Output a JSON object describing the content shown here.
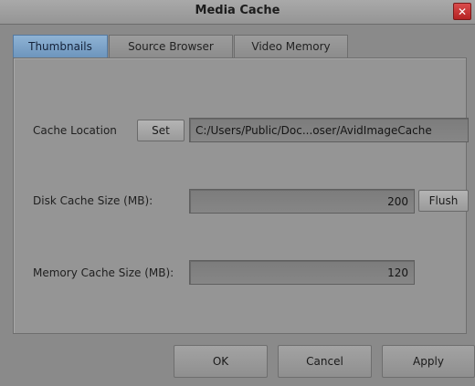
{
  "window": {
    "title": "Media Cache",
    "close_glyph": "✕"
  },
  "tabs": [
    {
      "label": "Thumbnails",
      "active": true
    },
    {
      "label": "Source Browser",
      "active": false
    },
    {
      "label": "Video Memory",
      "active": false
    }
  ],
  "cache_location": {
    "label": "Cache Location",
    "set_label": "Set",
    "path": "C:/Users/Public/Doc...oser/AvidImageCache"
  },
  "disk_cache": {
    "label": "Disk Cache Size (MB):",
    "value": "200",
    "flush_label": "Flush"
  },
  "memory_cache": {
    "label": "Memory Cache Size (MB):",
    "value": "120"
  },
  "footer": {
    "ok_label": "OK",
    "cancel_label": "Cancel",
    "apply_label": "Apply"
  },
  "colors": {
    "active_tab": "#7ea4ca",
    "close_button": "#c73333",
    "window_bg": "#8a8a8a"
  },
  "icons": {
    "close": "close-icon"
  }
}
